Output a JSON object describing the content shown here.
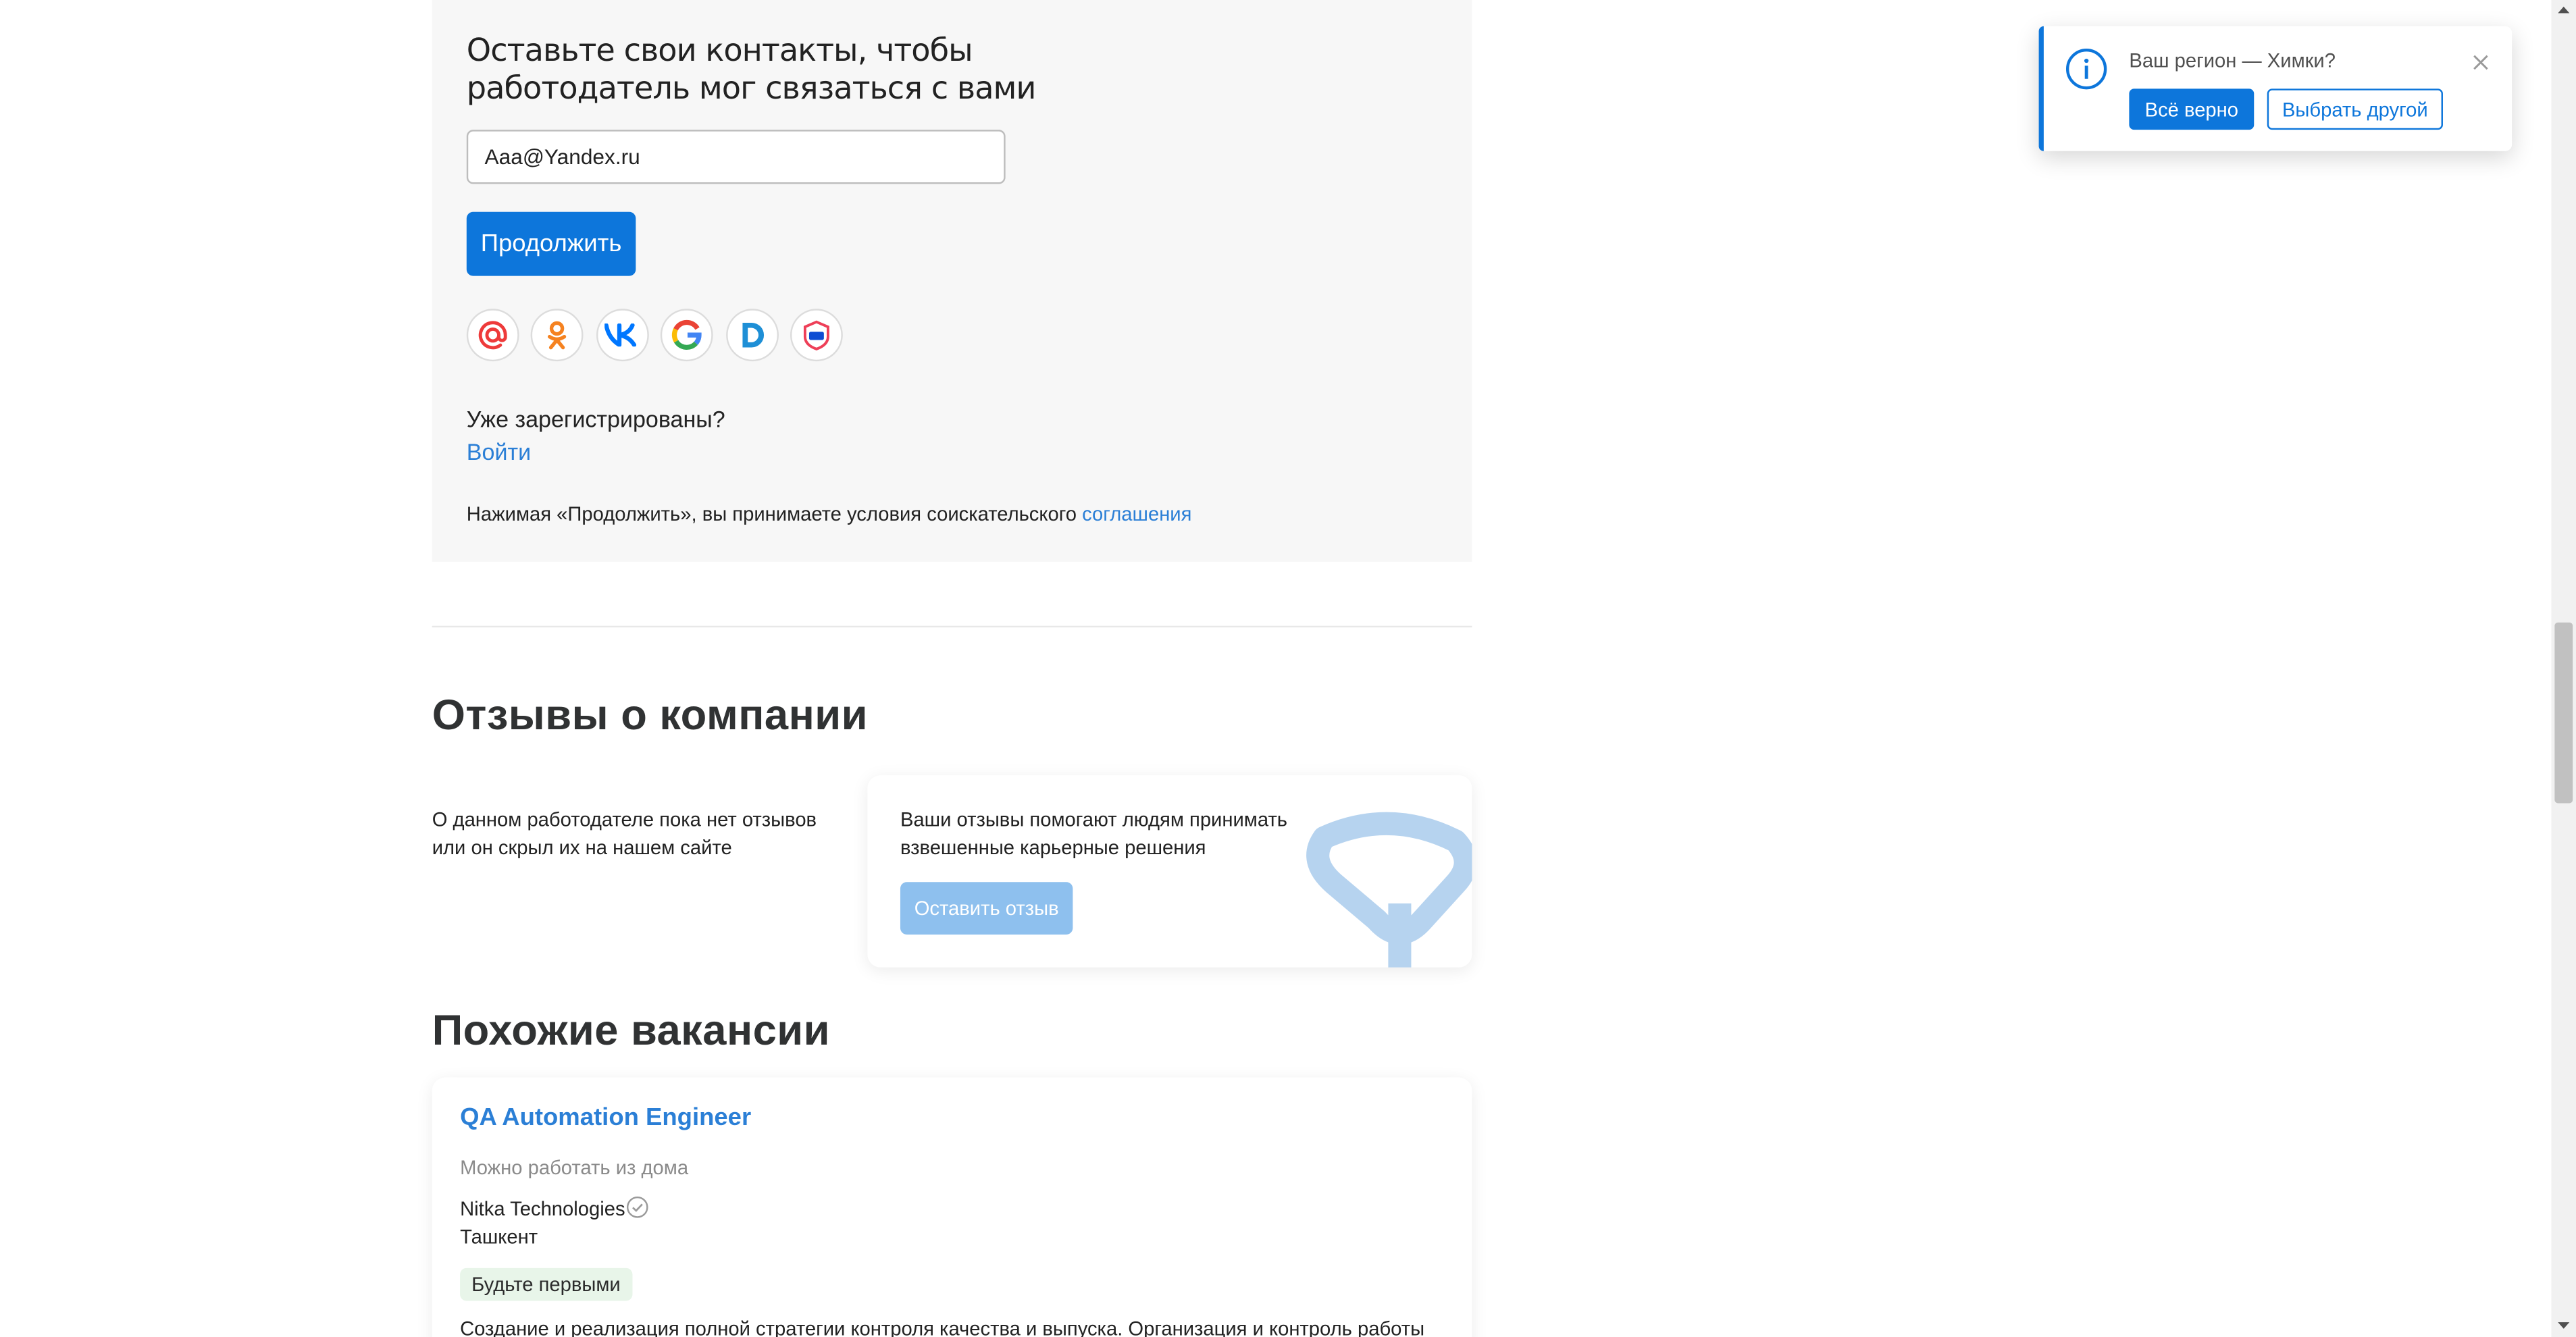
{
  "colors": {
    "accent": "#0d76db",
    "link": "#2b7fd6",
    "panel_bg": "#f7f7f7",
    "badge_bg": "#e8f5e9",
    "disabled_button": "#8ec0ee"
  },
  "signup": {
    "heading": "Оставьте свои контакты, чтобы работодатель мог связаться с вами",
    "email_value": "Aaa@Yandex.ru",
    "continue_label": "Продолжить",
    "social_icons": [
      "mailru-icon",
      "odnoklassniki-icon",
      "vk-icon",
      "google-icon",
      "d-icon",
      "gosuslugi-icon"
    ],
    "already_registered": "Уже зарегистрированы?",
    "login_label": "Войти",
    "agreement_text": "Нажимая «Продолжить», вы принимаете условия соискательского",
    "agreement_link": "соглашения"
  },
  "reviews": {
    "title": "Отзывы о компании",
    "no_reviews": "О данном работодателе пока нет отзывов или он скрыл их на нашем сайте",
    "card_text": "Ваши отзывы помогают людям принимать взвешенные карьерные решения",
    "leave_review_label": "Оставить отзыв"
  },
  "similar": {
    "title": "Похожие вакансии",
    "vacancy": {
      "title": "QA Automation Engineer",
      "remote": "Можно работать из дома",
      "company": "Nitka Technologies",
      "city": "Ташкент",
      "badge": "Будьте первыми",
      "description": "Создание и реализация полной стратегии контроля качества и выпуска. Организация и контроль работы"
    }
  },
  "region_popup": {
    "question": "Ваш регион — Химки?",
    "confirm_label": "Всё верно",
    "other_label": "Выбрать другой"
  }
}
